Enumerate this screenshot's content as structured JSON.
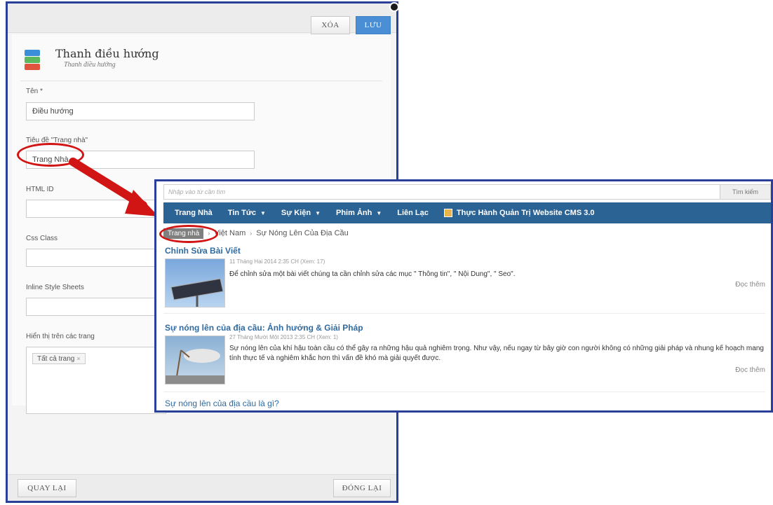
{
  "form": {
    "delete_label": "XÓA",
    "save_label": "LƯU",
    "title": "Thanh điều hướng",
    "subtitle": "Thanh điều hướng",
    "fields": {
      "name_label": "Tên *",
      "name_value": "Điều hướng",
      "home_title_label": "Tiêu đề \"Trang nhà\"",
      "home_title_value": "Trang Nhà",
      "html_id_label": "HTML ID",
      "css_class_label": "Css Class",
      "inline_style_label": "Inline Style Sheets",
      "pages_label": "Hiển thị trên các trang",
      "pages_tag": "Tất cả trang",
      "pages_tag_remove": "×"
    },
    "back_label": "QUAY LẠI",
    "close_label": "ĐÓNG LẠI"
  },
  "site": {
    "search_placeholder": "Nhập vào từ cần tìm",
    "search_button": "Tìm kiếm",
    "nav": [
      {
        "label": "Trang Nhà",
        "caret": ""
      },
      {
        "label": "Tin Tức",
        "caret": "▼"
      },
      {
        "label": "Sự Kiện",
        "caret": "▼"
      },
      {
        "label": "Phim Ảnh",
        "caret": "▼"
      },
      {
        "label": "Liên Lạc",
        "caret": ""
      },
      {
        "label": "Thực Hành Quản Trị Website CMS 3.0",
        "caret": ""
      }
    ],
    "breadcrumb": {
      "home": "Trang nhà",
      "sep": "›",
      "items": [
        "Việt Nam",
        "Sự Nóng Lên Của Địa Cầu"
      ]
    },
    "posts": [
      {
        "title": "Chỉnh Sửa Bài Viết",
        "meta": "11 Tháng Hai 2014 2:35 CH (Xem: 17)",
        "body": "Để chỉnh sửa một bài viết chúng ta cần chỉnh sửa các mục \" Thông tin\", \" Nội Dung\", \" Seo\".",
        "readmore": "Đọc thêm"
      },
      {
        "title": "Sự nóng lên của địa cầu: Ảnh hưởng & Giải Pháp",
        "meta": "27 Tháng Mười Một 2013 2:35 CH (Xem: 1)",
        "body": "Sự nóng lên của khí hậu toàn cầu có thể gây ra những hậu quả nghiêm trọng. Như vậy, nếu ngay từ bây giờ con người không có những giải pháp và nhung kế hoạch mang tính thực tế và nghiêm khắc hơn thì vấn đề khó mà giải quyết được.",
        "readmore": "Đọc thêm"
      },
      {
        "title": "Sự nóng lên của địa cầu là gì?"
      }
    ]
  },
  "colors": {
    "frame_blue": "#2a3f9a",
    "nav_blue": "#2c6395",
    "highlight_red": "#d11414",
    "link_blue": "#2f6aa0"
  }
}
